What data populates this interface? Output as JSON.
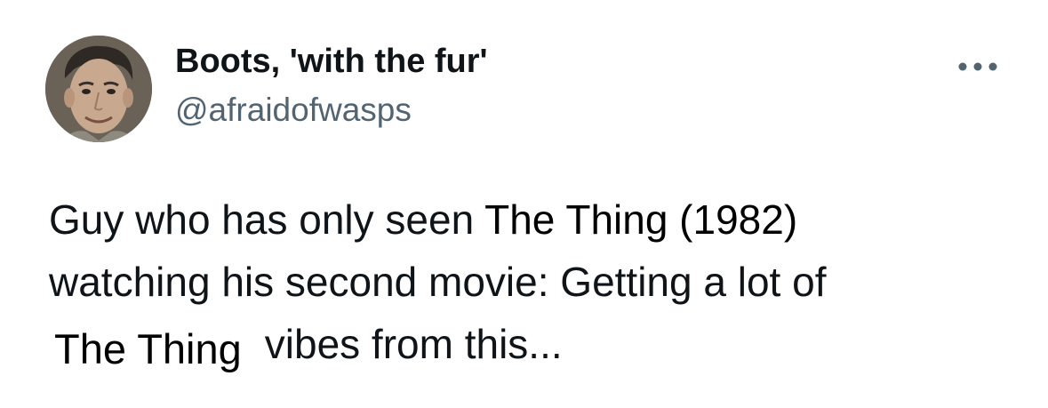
{
  "author": {
    "display_name": "Boots, 'with the fur'",
    "handle": "@afraidofwasps",
    "avatar_icon": "profile-photo-icon"
  },
  "menu": {
    "more_icon": "more-options-icon"
  },
  "tweet": {
    "line1_prefix": "Guy who has only seen ",
    "line1_pasted": "The Thing (1982)",
    "line2": "watching his second movie: Getting a lot of",
    "line3_pasted": "The Thing",
    "line3_suffix": "vibes from this..."
  },
  "colors": {
    "text": "#0f1419",
    "secondary": "#536471",
    "background": "#ffffff"
  }
}
